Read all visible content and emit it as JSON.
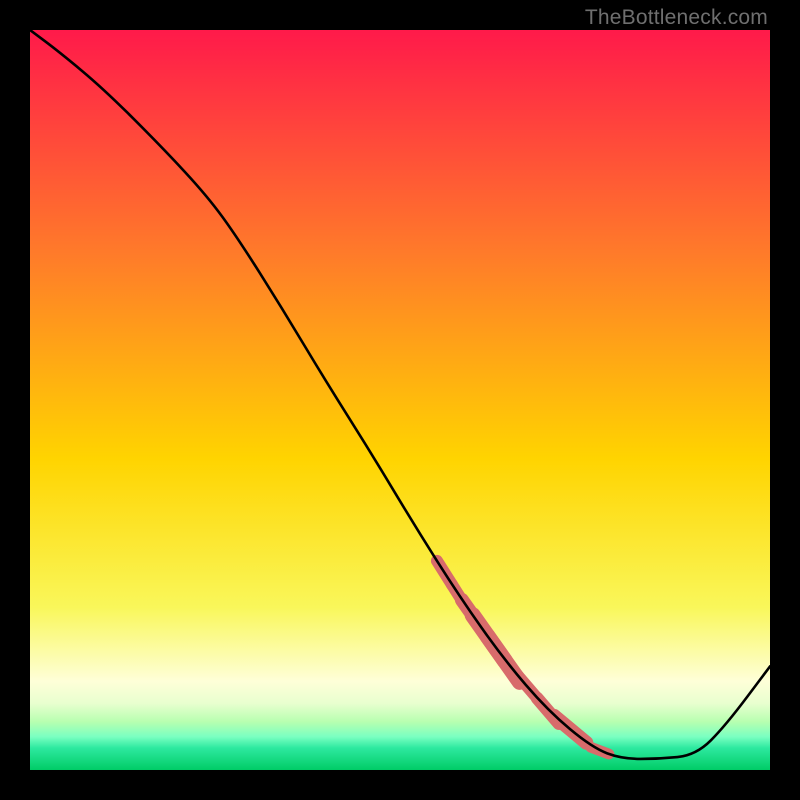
{
  "attribution": "TheBottleneck.com",
  "colors": {
    "top": "#ff1a4a",
    "mid1": "#ff6a2a",
    "mid2": "#ffd400",
    "mid3": "#fff670",
    "band1": "#f7ffd0",
    "band2": "#c9ffb2",
    "band3": "#7affc1",
    "band4": "#00e69a",
    "bottom": "#00cc66",
    "line": "#000000",
    "marker": "#d86b6b"
  },
  "chart_data": {
    "type": "line",
    "title": "",
    "xlabel": "",
    "ylabel": "",
    "xlim": [
      0,
      100
    ],
    "ylim": [
      0,
      100
    ],
    "x": [
      0,
      4,
      10,
      18,
      24,
      28,
      34,
      40,
      46,
      52,
      58,
      64,
      70,
      76,
      80,
      85,
      90,
      94,
      100
    ],
    "values": [
      100,
      97,
      92,
      84,
      77.5,
      72,
      62.5,
      52.5,
      43,
      33,
      23.5,
      15,
      8,
      3,
      1.5,
      1.5,
      2,
      6,
      14
    ],
    "markers": {
      "x": [
        56,
        58,
        60,
        62,
        64,
        67,
        70,
        73,
        77
      ],
      "values": [
        27,
        24,
        21,
        18,
        15,
        11.5,
        8,
        5,
        2.5
      ],
      "weight": [
        1,
        1,
        1.5,
        2,
        2,
        1,
        1.2,
        1.5,
        0.7
      ]
    }
  }
}
